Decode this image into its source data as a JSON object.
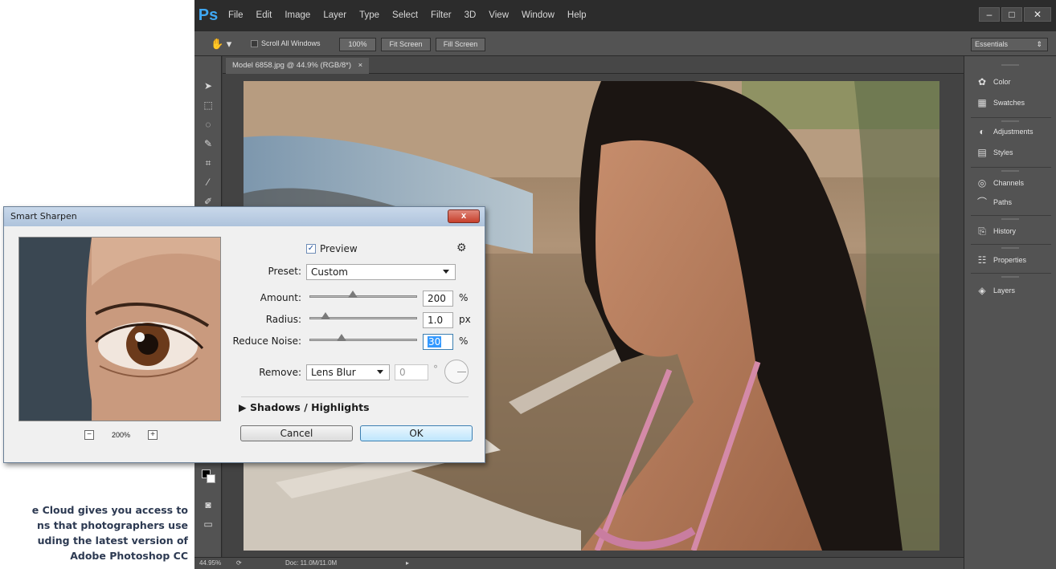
{
  "app": {
    "logo": "Ps",
    "menu": [
      "File",
      "Edit",
      "Image",
      "Layer",
      "Type",
      "Select",
      "Filter",
      "3D",
      "View",
      "Window",
      "Help"
    ],
    "window_buttons": [
      "–",
      "□",
      "✕"
    ]
  },
  "options_bar": {
    "scroll_all_windows": "Scroll All Windows",
    "btn_100": "100%",
    "btn_fit": "Fit Screen",
    "btn_fill": "Fill Screen",
    "workspace": "Essentials"
  },
  "document": {
    "tab_label": "Model 6858.jpg @ 44.9% (RGB/8*)",
    "tab_close": "×"
  },
  "status": {
    "zoom": "44.95%",
    "doc_info": "Doc: 11.0M/11.0M"
  },
  "panels": [
    {
      "label": "Color",
      "icon": "color-icon"
    },
    {
      "label": "Swatches",
      "icon": "swatches-icon"
    },
    {
      "label": "Adjustments",
      "icon": "adjustments-icon"
    },
    {
      "label": "Styles",
      "icon": "styles-icon"
    },
    {
      "label": "Channels",
      "icon": "channels-icon"
    },
    {
      "label": "Paths",
      "icon": "paths-icon"
    },
    {
      "label": "History",
      "icon": "history-icon"
    },
    {
      "label": "Properties",
      "icon": "properties-icon"
    },
    {
      "label": "Layers",
      "icon": "layers-icon"
    }
  ],
  "dialog": {
    "title": "Smart Sharpen",
    "close": "x",
    "preview_label": "Preview",
    "preview_checked": true,
    "preset_label": "Preset:",
    "preset_value": "Custom",
    "amount_label": "Amount:",
    "amount_value": "200",
    "amount_unit": "%",
    "amount_level": 0.4,
    "radius_label": "Radius:",
    "radius_value": "1.0",
    "radius_unit": "px",
    "radius_level": 0.15,
    "noise_label": "Reduce Noise:",
    "noise_value": "30",
    "noise_unit": "%",
    "noise_level": 0.3,
    "remove_label": "Remove:",
    "remove_value": "Lens Blur",
    "angle_value": "0",
    "angle_unit": "°",
    "shadows_label": "Shadows / Highlights",
    "cancel": "Cancel",
    "ok": "OK",
    "zoom_value": "200%",
    "zoom_minus": "−",
    "zoom_plus": "+"
  },
  "caption": {
    "lines": [
      "e Cloud gives you access to",
      "ns that photographers use",
      "uding the latest version of",
      "Adobe Photoshop CC"
    ]
  }
}
